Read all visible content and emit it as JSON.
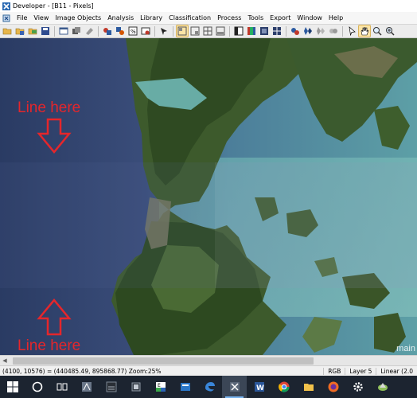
{
  "window": {
    "title": "Developer - [B11 - Pixels]"
  },
  "menu": {
    "items": [
      "File",
      "View",
      "Image Objects",
      "Analysis",
      "Library",
      "Classification",
      "Process",
      "Tools",
      "Export",
      "Window",
      "Help"
    ]
  },
  "toolbar": {
    "buttons": [
      {
        "icon": "open-project-icon"
      },
      {
        "icon": "save-project-icon"
      },
      {
        "icon": "open-image-icon"
      },
      {
        "icon": "save-image-icon"
      },
      {
        "icon": "new-window-icon"
      },
      {
        "icon": "view-layers-icon"
      },
      {
        "icon": "delete-icon"
      },
      {
        "icon": "settings-1-icon"
      },
      {
        "icon": "settings-2-icon"
      },
      {
        "icon": "settings-3-icon"
      },
      {
        "icon": "settings-4-icon"
      },
      {
        "icon": "pointer-arrow-icon"
      },
      {
        "icon": "workspace-layout-1-icon"
      },
      {
        "icon": "workspace-layout-2-icon"
      },
      {
        "icon": "workspace-layout-3-icon"
      },
      {
        "icon": "workspace-layout-4-icon"
      },
      {
        "icon": "single-view-icon"
      },
      {
        "icon": "layer-mix-icon"
      },
      {
        "icon": "pixel-view-icon"
      },
      {
        "icon": "outline-view-icon"
      },
      {
        "icon": "classification-view-icon"
      },
      {
        "icon": "object-mean-icon"
      },
      {
        "icon": "polygon-view-icon"
      },
      {
        "icon": "skeleton-view-icon"
      },
      {
        "icon": "pointer-select-icon"
      },
      {
        "icon": "pan-hand-icon"
      },
      {
        "icon": "zoom-icon"
      },
      {
        "icon": "zoom-in-icon"
      }
    ]
  },
  "viewport": {
    "annotation_top": "Line here",
    "annotation_bottom": "Line here",
    "watermark": "main"
  },
  "status": {
    "coords": "(4100, 10576) = (440485.49, 895868.77)  Zoom:25%",
    "mode": "RGB",
    "layer": "Layer 5",
    "stretch": "Linear (2.0"
  },
  "taskbar": {
    "items": [
      {
        "icon": "windows-start-icon"
      },
      {
        "icon": "search-circle-icon"
      },
      {
        "icon": "task-view-icon"
      },
      {
        "icon": "app-tile-icon"
      },
      {
        "icon": "dark-app-icon"
      },
      {
        "icon": "stack-app-icon"
      },
      {
        "icon": "ecognition-icon"
      },
      {
        "icon": "blue-app-icon"
      },
      {
        "icon": "edge-browser-icon"
      },
      {
        "icon": "developer-app-icon"
      },
      {
        "icon": "word-icon"
      },
      {
        "icon": "chrome-icon"
      },
      {
        "icon": "file-explorer-icon"
      },
      {
        "icon": "firefox-icon"
      },
      {
        "icon": "gear-icon"
      },
      {
        "icon": "geo-app-icon"
      }
    ]
  }
}
